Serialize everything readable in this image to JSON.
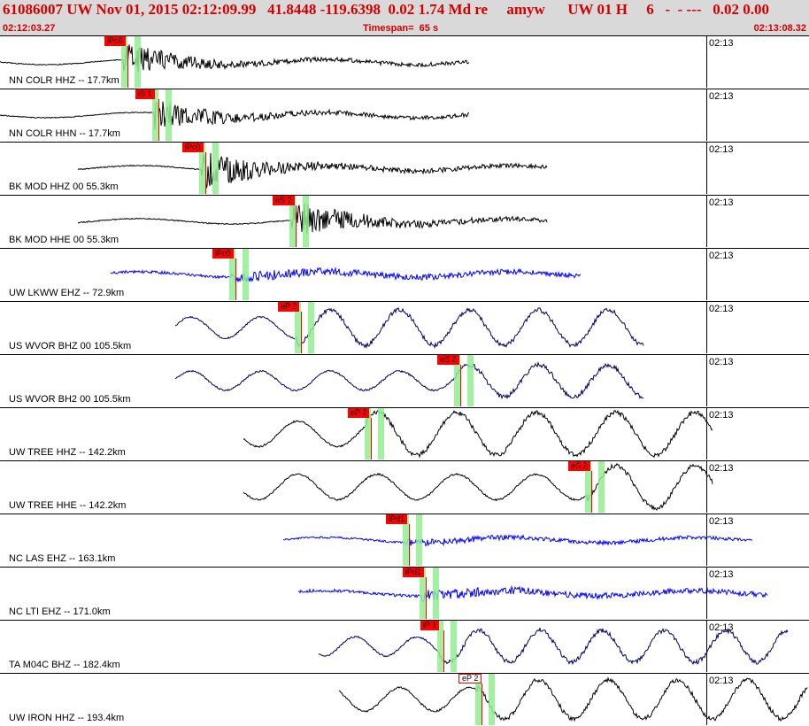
{
  "header": {
    "title": "61086007 UW Nov 01, 2015 02:12:09.99   41.8448 -119.6398  0.02 1.74 Md re     amyw      UW 01 H     6   -  - ---   0.02 0.00",
    "start_time": "02:12:03.27",
    "timespan": "Timespan=  65 s",
    "end_time": "02:13:08.32"
  },
  "panels": [
    {
      "channel": "NN COLR HHZ -- 17.7km",
      "time_label": "02:13",
      "pick": "iPc0",
      "color": "#000000",
      "amp": 12,
      "freq": 0.7,
      "start": 0,
      "end": 530,
      "onset": 140
    },
    {
      "channel": "NN COLR HHN -- 17.7km",
      "time_label": "02:13",
      "pick": "iS 1",
      "color": "#000000",
      "amp": 12,
      "freq": 0.8,
      "start": 0,
      "end": 530,
      "onset": 175
    },
    {
      "channel": "BK MOD HHZ 00 55.3km",
      "time_label": "02:13",
      "pick": "iPc0",
      "color": "#000000",
      "amp": 14,
      "freq": 0.8,
      "start": 88,
      "end": 618,
      "onset": 228
    },
    {
      "channel": "BK MOD HHE 00 55.3km",
      "time_label": "02:13",
      "pick": "eS 2",
      "color": "#000000",
      "amp": 14,
      "freq": 0.8,
      "start": 88,
      "end": 618,
      "onset": 330
    },
    {
      "channel": "UW LKWW EHZ -- 72.9km",
      "time_label": "02:13",
      "pick": "iPc0",
      "color": "#0000ff",
      "amp": 15,
      "freq": 1.2,
      "start": 125,
      "end": 656,
      "onset": 262
    },
    {
      "channel": "US WVOR BHZ 00 105.5km",
      "time_label": "02:13",
      "pick": "eP 2",
      "color": "#000060",
      "amp": 20,
      "freq": 0.08,
      "start": 198,
      "end": 727,
      "onset": 336
    },
    {
      "channel": "US WVOR BH2 00 105.5km",
      "time_label": "02:13",
      "pick": "eS 2",
      "color": "#000060",
      "amp": 18,
      "freq": 0.08,
      "start": 198,
      "end": 727,
      "onset": 516
    },
    {
      "channel": "UW TREE HHZ -- 142.2km",
      "time_label": "02:13",
      "pick": "eP 2",
      "color": "#000000",
      "amp": 24,
      "freq": 0.07,
      "start": 275,
      "end": 805,
      "onset": 415
    },
    {
      "channel": "UW TREE HHE -- 142.2km",
      "time_label": "02:13",
      "pick": "eS 2",
      "color": "#000000",
      "amp": 24,
      "freq": 0.07,
      "start": 275,
      "end": 805,
      "onset": 664
    },
    {
      "channel": "NC LAS EHZ -- 163.1km",
      "time_label": "02:13",
      "pick": "iPd1",
      "color": "#0000ff",
      "amp": 10,
      "freq": 1.3,
      "start": 320,
      "end": 850,
      "onset": 458
    },
    {
      "channel": "NC LTI EHZ -- 171.0km",
      "time_label": "02:13",
      "pick": "iPd1",
      "color": "#0000ff",
      "amp": 15,
      "freq": 1.3,
      "start": 337,
      "end": 867,
      "onset": 477
    },
    {
      "channel": "TA M04C BHZ -- 182.4km",
      "time_label": "02:13",
      "pick": "iP 1",
      "color": "#000060",
      "amp": 18,
      "freq": 0.09,
      "start": 360,
      "end": 890,
      "onset": 497
    },
    {
      "channel": "UW IRON HHZ -- 193.4km",
      "time_label": "02:13",
      "pick": "eP 2",
      "color": "#000000",
      "amp": 22,
      "freq": 0.08,
      "start": 383,
      "end": 912,
      "onset": 540
    }
  ]
}
